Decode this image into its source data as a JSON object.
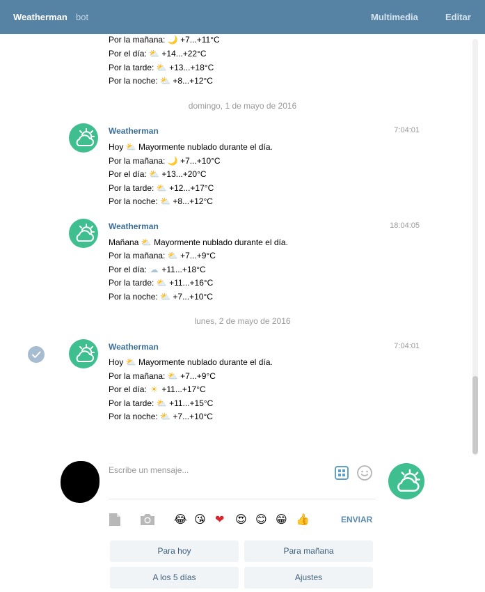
{
  "header": {
    "title": "Weatherman",
    "badge": "bot",
    "multimedia": "Multimedia",
    "edit": "Editar"
  },
  "messages": {
    "top_partial": [
      "Por la mañana:",
      "+7...+11°C",
      "Por el día:",
      "+14...+22°C",
      "Por la tarde:",
      "+13...+18°C",
      "Por la noche:",
      "+8...+12°C"
    ],
    "date1": "domingo, 1 de mayo de 2016",
    "msg1": {
      "author": "Weatherman",
      "time": "7:04:01",
      "l1a": "Hoy",
      "l1b": "Mayormente nublado durante el día.",
      "l2a": "Por la mañana:",
      "l2b": "+7...+10°C",
      "l3a": "Por el día:",
      "l3b": "+13...+20°C",
      "l4a": "Por la tarde:",
      "l4b": "+12...+17°C",
      "l5a": "Por la noche:",
      "l5b": "+8...+12°C"
    },
    "msg2": {
      "author": "Weatherman",
      "time": "18:04:05",
      "l1a": "Mañana",
      "l1b": "Mayormente nublado durante el día.",
      "l2a": "Por la mañana:",
      "l2b": "+7...+9°C",
      "l3a": "Por el día:",
      "l3b": "+11...+18°C",
      "l4a": "Por la tarde:",
      "l4b": "+11...+16°C",
      "l5a": "Por la noche:",
      "l5b": "+7...+10°C"
    },
    "date2": "lunes, 2 de mayo de 2016",
    "msg3": {
      "author": "Weatherman",
      "time": "7:04:01",
      "l1a": "Hoy",
      "l1b": "Mayormente nublado durante el día.",
      "l2a": "Por la mañana:",
      "l2b": "+7...+9°C",
      "l3a": "Por el día:",
      "l3b": "+11...+17°C",
      "l4a": "Por la tarde:",
      "l4b": "+11...+15°C",
      "l5a": "Por la noche:",
      "l5b": "+7...+10°C"
    }
  },
  "emoji": {
    "moon": "🌙",
    "partly_cloudy": "⛅",
    "cloud": "☁",
    "sun": "☀"
  },
  "composer": {
    "placeholder": "Escribe un mensaje...",
    "send": "ENVIAR",
    "quick_emoji": [
      "😂",
      "😘",
      "❤",
      "😍",
      "😊",
      "😁",
      "👍"
    ]
  },
  "keyboard": {
    "today": "Para hoy",
    "tomorrow": "Para mañana",
    "five_days": "A los 5 días",
    "settings": "Ajustes"
  },
  "colors": {
    "header_bg": "#5682a3",
    "bot_avatar": "#3fbf8f",
    "author": "#3a6d99",
    "button_bg": "#f0f4f7"
  }
}
